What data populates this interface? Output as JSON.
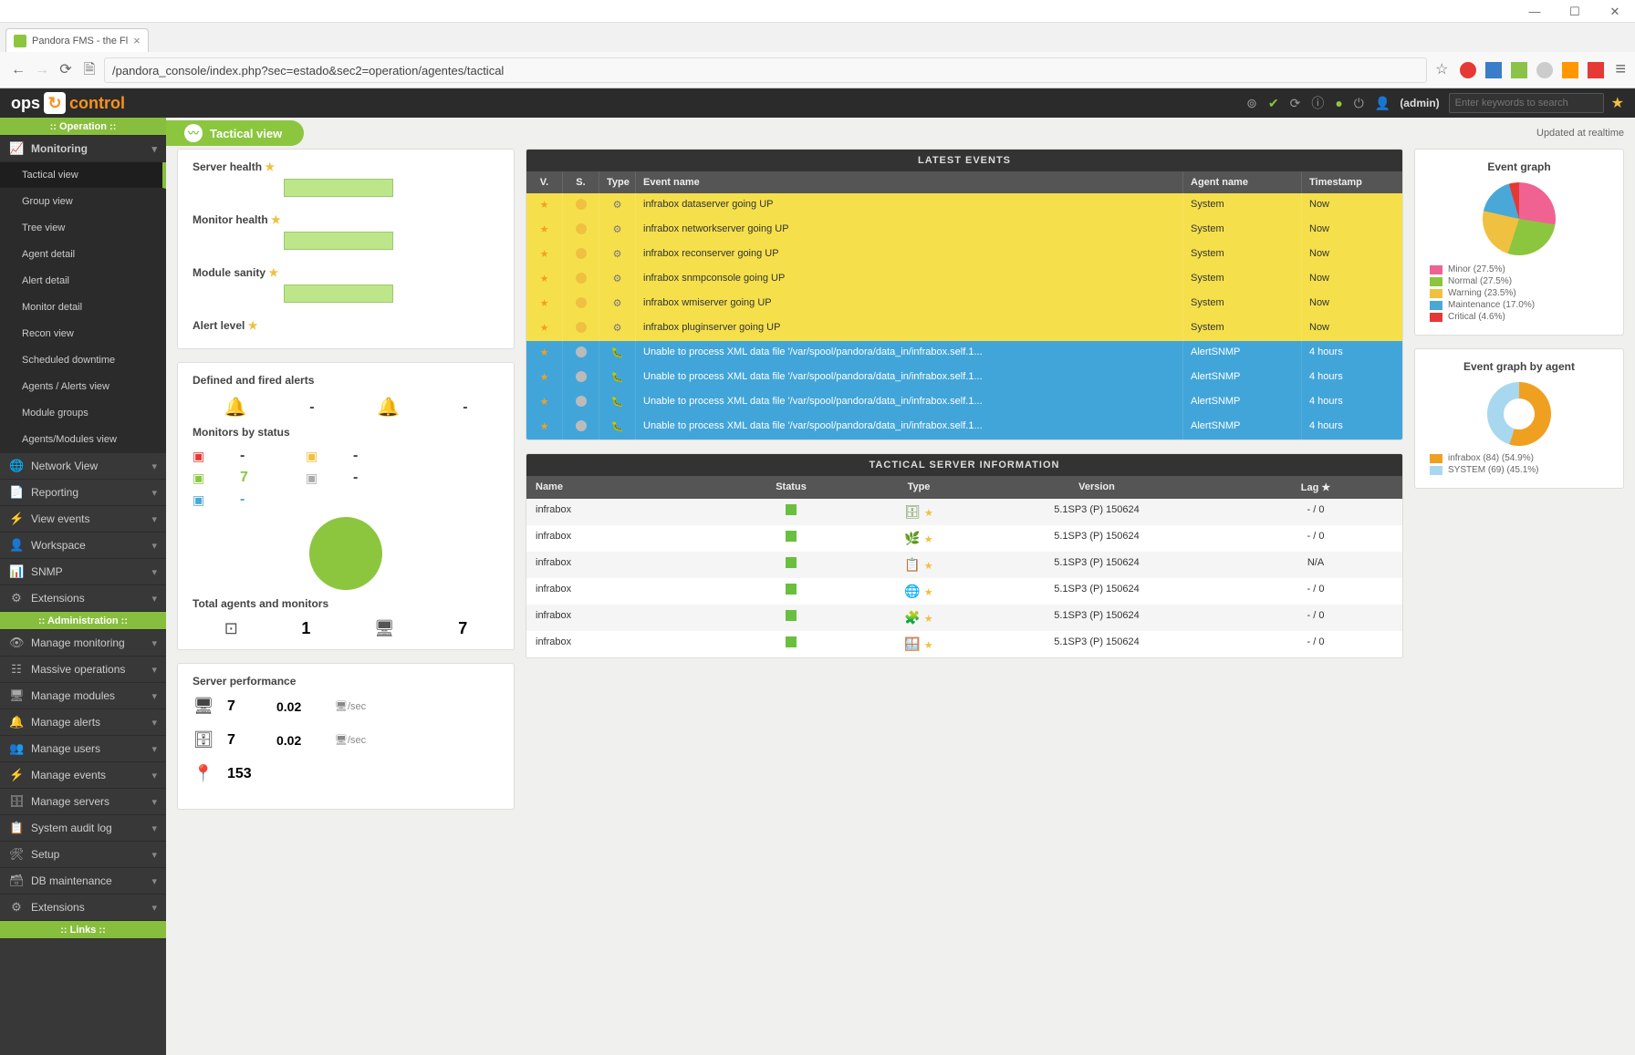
{
  "browser": {
    "tab_title": "Pandora FMS - the Fl",
    "url": "/pandora_console/index.php?sec=estado&sec2=operation/agentes/tactical"
  },
  "brand": {
    "part1": "ops",
    "part2": "control"
  },
  "topbar": {
    "user": "(admin)",
    "search_placeholder": "Enter keywords to search"
  },
  "sidebar": {
    "section_op": ":: Operation ::",
    "monitoring": "Monitoring",
    "sub": [
      {
        "label": "Tactical view",
        "active": true
      },
      {
        "label": "Group view"
      },
      {
        "label": "Tree view"
      },
      {
        "label": "Agent detail"
      },
      {
        "label": "Alert detail"
      },
      {
        "label": "Monitor detail"
      },
      {
        "label": "Recon view"
      },
      {
        "label": "Scheduled downtime"
      },
      {
        "label": "Agents / Alerts view"
      },
      {
        "label": "Module groups"
      },
      {
        "label": "Agents/Modules view"
      }
    ],
    "ops": [
      {
        "icon": "🌐",
        "label": "Network View"
      },
      {
        "icon": "📄",
        "label": "Reporting"
      },
      {
        "icon": "⚡",
        "label": "View events"
      },
      {
        "icon": "👤",
        "label": "Workspace"
      },
      {
        "icon": "📊",
        "label": "SNMP"
      },
      {
        "icon": "⚙",
        "label": "Extensions"
      }
    ],
    "section_admin": ":: Administration ::",
    "admin": [
      {
        "icon": "👁",
        "label": "Manage monitoring"
      },
      {
        "icon": "☷",
        "label": "Massive operations"
      },
      {
        "icon": "🖥",
        "label": "Manage modules"
      },
      {
        "icon": "🔔",
        "label": "Manage alerts"
      },
      {
        "icon": "👥",
        "label": "Manage users"
      },
      {
        "icon": "⚡",
        "label": "Manage events"
      },
      {
        "icon": "🗄",
        "label": "Manage servers"
      },
      {
        "icon": "📋",
        "label": "System audit log"
      },
      {
        "icon": "🛠",
        "label": "Setup"
      },
      {
        "icon": "🗃",
        "label": "DB maintenance"
      },
      {
        "icon": "⚙",
        "label": "Extensions"
      }
    ],
    "section_links": ":: Links ::"
  },
  "page": {
    "title": "Tactical view",
    "updated": "Updated at realtime"
  },
  "health": {
    "server": "Server health",
    "monitor": "Monitor health",
    "module": "Module sanity",
    "alert": "Alert level"
  },
  "defined_fired": {
    "title": "Defined and fired alerts",
    "v1": "-",
    "v2": "-"
  },
  "mon_by_status": {
    "title": "Monitors by status",
    "red": "-",
    "yellow": "-",
    "green": "7",
    "gray": "-",
    "blue": "-"
  },
  "totals": {
    "title": "Total agents and monitors",
    "agents": "1",
    "monitors": "7"
  },
  "perf": {
    "title": "Server performance",
    "rows": [
      {
        "icon": "🖥",
        "n": "7",
        "r": "0.02",
        "u": "🖥/sec"
      },
      {
        "icon": "🗄",
        "n": "7",
        "r": "0.02",
        "u": "🖥/sec"
      },
      {
        "icon": "📍",
        "n": "153",
        "r": "",
        "u": ""
      }
    ]
  },
  "events": {
    "title": "LATEST EVENTS",
    "head": {
      "v": "V.",
      "s": "S.",
      "t": "Type",
      "n": "Event name",
      "a": "Agent name",
      "ts": "Timestamp"
    },
    "rows": [
      {
        "cls": "y",
        "star": "★",
        "dot": "y",
        "gear": true,
        "name": "infrabox dataserver going UP",
        "agent": "System",
        "ts": "Now"
      },
      {
        "cls": "y",
        "star": "★",
        "dot": "y",
        "gear": true,
        "name": "infrabox networkserver going UP",
        "agent": "System",
        "ts": "Now"
      },
      {
        "cls": "y",
        "star": "★",
        "dot": "y",
        "gear": true,
        "name": "infrabox reconserver going UP",
        "agent": "System",
        "ts": "Now"
      },
      {
        "cls": "y",
        "star": "★",
        "dot": "y",
        "gear": true,
        "name": "infrabox snmpconsole going UP",
        "agent": "System",
        "ts": "Now"
      },
      {
        "cls": "y",
        "star": "★",
        "dot": "y",
        "gear": true,
        "name": "infrabox wmiserver going UP",
        "agent": "System",
        "ts": "Now"
      },
      {
        "cls": "y",
        "star": "★",
        "dot": "y",
        "gear": true,
        "name": "infrabox pluginserver going UP",
        "agent": "System",
        "ts": "Now"
      },
      {
        "cls": "b",
        "star": "★",
        "dot": "g",
        "worm": true,
        "name": "Unable to process XML data file '/var/spool/pandora/data_in/infrabox.self.1...",
        "agent": "AlertSNMP",
        "ts": "4 hours"
      },
      {
        "cls": "b",
        "star": "★",
        "dot": "g",
        "worm": true,
        "name": "Unable to process XML data file '/var/spool/pandora/data_in/infrabox.self.1...",
        "agent": "AlertSNMP",
        "ts": "4 hours"
      },
      {
        "cls": "b",
        "star": "★",
        "dot": "g",
        "worm": true,
        "name": "Unable to process XML data file '/var/spool/pandora/data_in/infrabox.self.1...",
        "agent": "AlertSNMP",
        "ts": "4 hours"
      },
      {
        "cls": "b",
        "star": "★",
        "dot": "g",
        "worm": true,
        "name": "Unable to process XML data file '/var/spool/pandora/data_in/infrabox.self.1...",
        "agent": "AlertSNMP",
        "ts": "4 hours"
      }
    ]
  },
  "servers": {
    "title": "TACTICAL SERVER INFORMATION",
    "head": {
      "n": "Name",
      "s": "Status",
      "t": "Type",
      "v": "Version",
      "l": "Lag ★"
    },
    "rows": [
      {
        "name": "infrabox",
        "typ": "🗄",
        "ver": "5.1SP3 (P) 150624",
        "lag": "- / 0"
      },
      {
        "name": "infrabox",
        "typ": "🌿",
        "ver": "5.1SP3 (P) 150624",
        "lag": "- / 0"
      },
      {
        "name": "infrabox",
        "typ": "📋",
        "ver": "5.1SP3 (P) 150624",
        "lag": "N/A"
      },
      {
        "name": "infrabox",
        "typ": "🌐",
        "ver": "5.1SP3 (P) 150624",
        "lag": "- / 0"
      },
      {
        "name": "infrabox",
        "typ": "🧩",
        "ver": "5.1SP3 (P) 150624",
        "lag": "- / 0"
      },
      {
        "name": "infrabox",
        "typ": "🪟",
        "ver": "5.1SP3 (P) 150624",
        "lag": "- / 0"
      }
    ]
  },
  "evgraph": {
    "title": "Event graph",
    "legend": [
      {
        "c": "pk",
        "label": "Minor (27.5%)"
      },
      {
        "c": "gn",
        "label": "Normal (27.5%)"
      },
      {
        "c": "yl",
        "label": "Warning (23.5%)"
      },
      {
        "c": "bl",
        "label": "Maintenance (17.0%)"
      },
      {
        "c": "rd",
        "label": "Critical (4.6%)"
      }
    ]
  },
  "evgraph_agent": {
    "title": "Event graph by agent",
    "legend": [
      {
        "c": "or",
        "label": "infrabox (84) (54.9%)"
      },
      {
        "c": "lb",
        "label": "SYSTEM (69) (45.1%)"
      }
    ]
  },
  "chart_data": [
    {
      "type": "pie",
      "title": "Event graph",
      "series": [
        {
          "name": "Minor",
          "value": 27.5
        },
        {
          "name": "Normal",
          "value": 27.5
        },
        {
          "name": "Warning",
          "value": 23.5
        },
        {
          "name": "Maintenance",
          "value": 17.0
        },
        {
          "name": "Critical",
          "value": 4.6
        }
      ]
    },
    {
      "type": "pie",
      "title": "Event graph by agent",
      "series": [
        {
          "name": "infrabox",
          "count": 84,
          "value": 54.9
        },
        {
          "name": "SYSTEM",
          "count": 69,
          "value": 45.1
        }
      ]
    },
    {
      "type": "pie",
      "title": "Monitors by status",
      "series": [
        {
          "name": "Normal",
          "value": 7
        }
      ]
    }
  ]
}
